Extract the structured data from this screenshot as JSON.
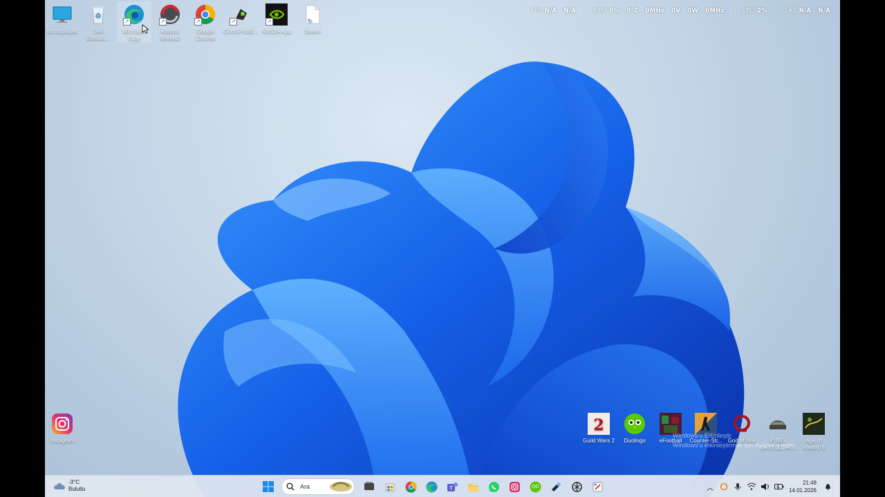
{
  "desktop": {
    "icons_top": [
      {
        "label": "Bu bilgisayar",
        "icon": "monitor-icon"
      },
      {
        "label": "Geri Dönüşü...",
        "icon": "recycle-bin-icon"
      },
      {
        "label": "Microsoft Edge",
        "icon": "edge-icon"
      },
      {
        "label": "Kontrol Merkezi",
        "icon": "control-center-icon"
      },
      {
        "label": "Google Chrome",
        "icon": "chrome-icon"
      },
      {
        "label": "GhostProWi...",
        "icon": "ghost-icon"
      },
      {
        "label": "NVIDIA App",
        "icon": "nvidia-icon"
      },
      {
        "label": "Steam",
        "icon": "file-icon"
      }
    ],
    "icon_instagram": {
      "label": "Instagram",
      "icon": "instagram-icon"
    },
    "icons_bottom_right": [
      {
        "label": "Guild Wars 2",
        "icon": "guild-wars-icon"
      },
      {
        "label": "Duolingo",
        "icon": "duolingo-icon"
      },
      {
        "label": "eFootball",
        "icon": "efootball-icon"
      },
      {
        "label": "Counter-Str...",
        "icon": "counter-strike-icon"
      },
      {
        "label": "God of War",
        "icon": "god-of-war-icon"
      },
      {
        "label": "PUBG BATTLEGRO...",
        "icon": "pubg-icon"
      },
      {
        "label": "Age of History II",
        "icon": "age-of-history-icon"
      }
    ],
    "watermark": {
      "line1": "Windows'u Etkinleştir",
      "line2": "Windows'u etkinleştirmek için Ayarlar'a gidin."
    }
  },
  "overlay": {
    "fps_label": "FPS",
    "fps_value": "N/A",
    "fps_value2": "N/A",
    "gpu_label": "GPU",
    "gpu_usage": "0%",
    "gpu_temp": "0°C",
    "gpu_clock": "0MHz",
    "gpu_volt": "0V",
    "gpu_power": "0W",
    "gpu_mem_clock": "0MHz",
    "cpu_label": "CPU",
    "cpu_usage": "2%",
    "lat_label": "LAT",
    "lat_value": "N/A",
    "lat_value2": "N/A"
  },
  "taskbar": {
    "weather_temp": "-3°C",
    "weather_desc": "Bulutlu",
    "search_placeholder": "Ara",
    "pinned": [
      "task-view-icon",
      "store-icon",
      "chrome-icon",
      "edge-icon",
      "teams-icon",
      "file-explorer-icon",
      "whatsapp-icon",
      "instagram-icon",
      "duolingo-icon",
      "steam-icon",
      "chatgpt-icon",
      "snipping-tool-icon"
    ],
    "time": "21:49",
    "date": "14.01.2026"
  }
}
